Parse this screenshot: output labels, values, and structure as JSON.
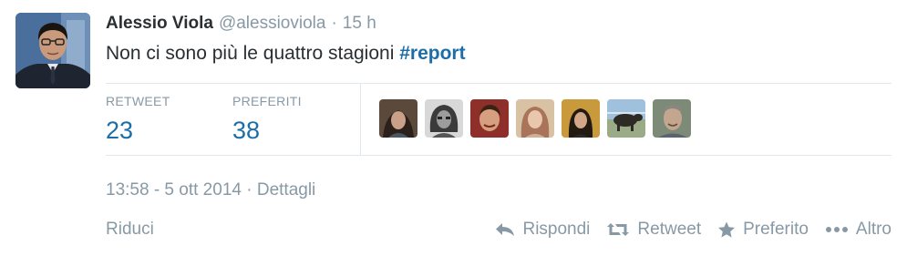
{
  "tweet": {
    "fullname": "Alessio Viola",
    "username": "@alessioviola",
    "separator": "·",
    "time_ago": "15 h",
    "text": "Non ci sono più le quattro stagioni",
    "hashtag": "#report"
  },
  "stats": {
    "retweet_label": "RETWEET",
    "retweet_count": "23",
    "fav_label": "PREFERITI",
    "fav_count": "38"
  },
  "favoriters_count_shown": 7,
  "timestamp": {
    "datetime": "13:58 - 5 ott 2014",
    "separator": "·",
    "details": "Dettagli"
  },
  "footer": {
    "reduce_label": "Riduci",
    "actions": [
      {
        "label": "Rispondi",
        "icon": "reply-icon"
      },
      {
        "label": "Retweet",
        "icon": "retweet-icon"
      },
      {
        "label": "Preferito",
        "icon": "star-icon"
      },
      {
        "label": "Altro",
        "icon": "more-icon"
      }
    ]
  },
  "colors": {
    "link_blue": "#1b6ea8",
    "muted_gray": "#8899a6",
    "text_dark": "#292f33",
    "divider": "#e1e8ed"
  }
}
